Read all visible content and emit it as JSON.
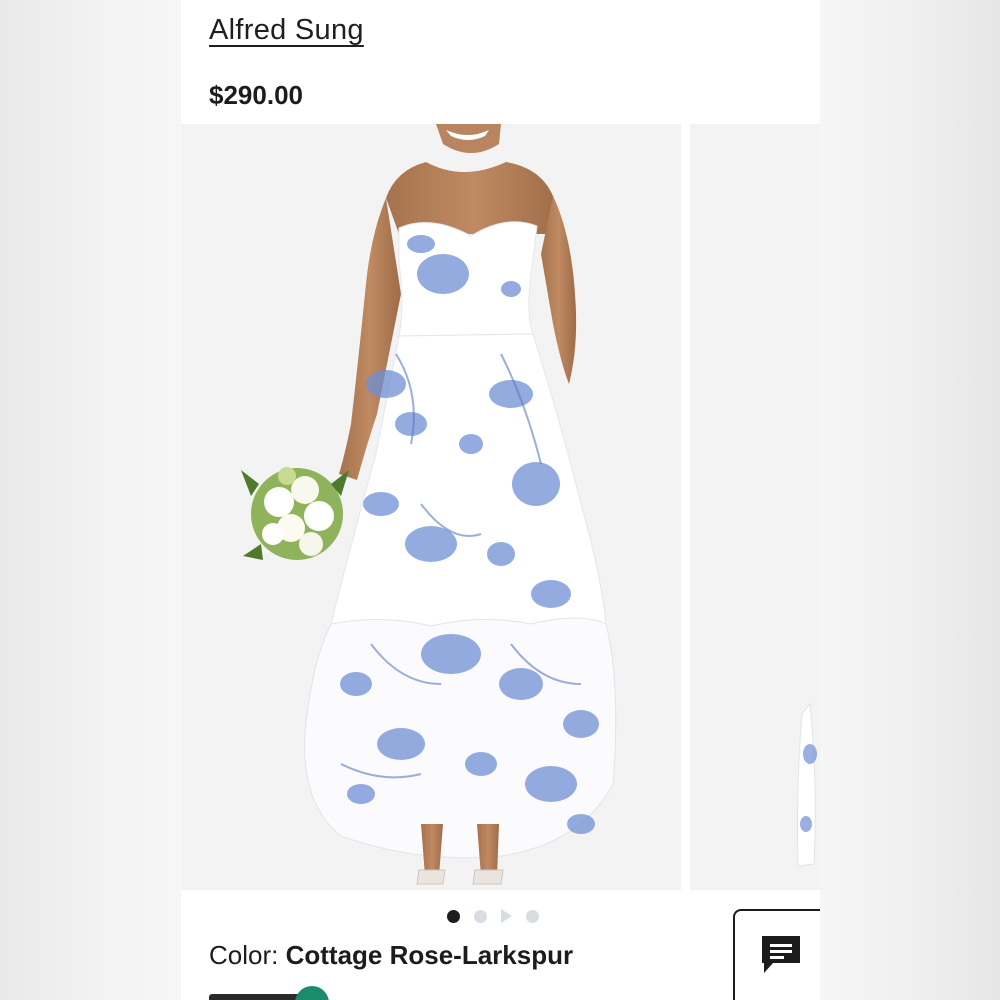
{
  "product": {
    "brand": "Alfred Sung",
    "price": "$290.00",
    "color_label": "Color:",
    "color_value": "Cottage Rose-Larkspur"
  },
  "carousel": {
    "image_subject": "Model wearing strapless white high-low gown with blue floral print, holding white and green bouquet",
    "slide_count": 4,
    "active_slide": 1
  },
  "icons": {
    "chat": "chat-bubble-icon"
  },
  "colors": {
    "text": "#1c1c1c",
    "dot_active": "#1d1d1d",
    "dot_inactive": "#d8dde2",
    "floral_blue": "#6f8fd4",
    "swatch_green": "#1c8a6c"
  }
}
